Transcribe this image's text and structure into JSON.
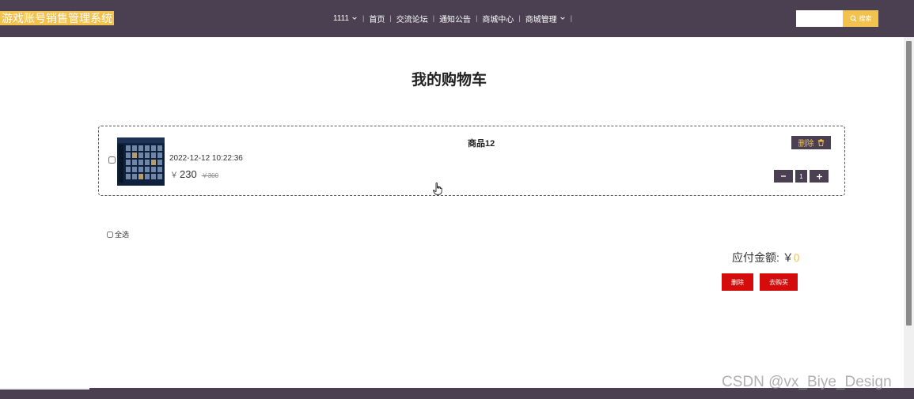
{
  "app": {
    "logo_text": "游戏账号销售管理系统"
  },
  "nav": {
    "user": "1111",
    "items": [
      {
        "label": "首页",
        "has_dropdown": false
      },
      {
        "label": "交流论坛",
        "has_dropdown": false
      },
      {
        "label": "通知公告",
        "has_dropdown": false
      },
      {
        "label": "商城中心",
        "has_dropdown": false
      },
      {
        "label": "商城管理",
        "has_dropdown": true
      }
    ],
    "search_value": "",
    "search_button": "搜索"
  },
  "page": {
    "title": "我的购物车"
  },
  "cart": {
    "items": [
      {
        "name": "商品12",
        "date": "2022-12-12 10:22:36",
        "currency": "￥",
        "price": "230",
        "original_price": "￥300",
        "quantity": "1",
        "delete_label": "删除",
        "checked": false
      }
    ],
    "select_all_label": "全选",
    "total_label": "应付金额: ￥",
    "total_amount": "0",
    "delete_button": "删除",
    "buy_button": "去购买"
  },
  "watermark": "CSDN @vx_Biye_Design",
  "colors": {
    "nav_bg": "#4a4051",
    "accent": "#f2c14e",
    "danger": "#d40c0c"
  }
}
